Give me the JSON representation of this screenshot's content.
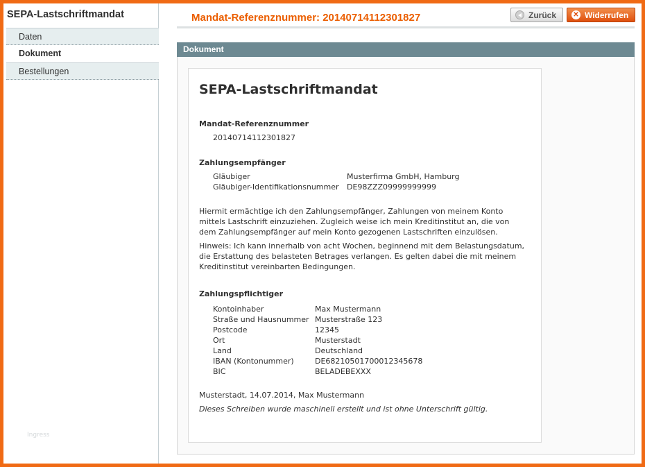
{
  "sidebar": {
    "title": "SEPA-Lastschriftmandat",
    "tabs": [
      {
        "label": "Daten",
        "active": false
      },
      {
        "label": "Dokument",
        "active": true
      },
      {
        "label": "Bestellungen",
        "active": false
      }
    ],
    "footnote": "Ingress"
  },
  "header": {
    "title": "Mandat-Referenznummer: 20140714112301827",
    "back_label": "Zurück",
    "back_icon": "arrow-left-circle-icon",
    "revoke_label": "Widerrufen",
    "revoke_icon": "x-circle-icon"
  },
  "section": {
    "title": "Dokument"
  },
  "document": {
    "title": "SEPA-Lastschriftmandat",
    "ref_heading": "Mandat-Referenznummer",
    "ref_value": "20140714112301827",
    "payee_heading": "Zahlungsempfänger",
    "payee": [
      {
        "key": "Gläubiger",
        "value": "Musterfirma GmbH, Hamburg"
      },
      {
        "key": "Gläubiger-Identifikationsnummer",
        "value": "DE98ZZZ09999999999"
      }
    ],
    "authorization_text": "Hiermit ermächtige ich den Zahlungsempfänger, Zahlungen von meinem Konto mittels Lastschrift einzuziehen. Zugleich weise ich mein Kreditinstitut an, die von dem Zahlungsempfänger auf mein Konto gezogenen Lastschriften einzulösen.",
    "notice_text": "Hinweis: Ich kann innerhalb von acht Wochen, beginnend mit dem Belastungsdatum, die Erstattung des belasteten Betrages verlangen. Es gelten dabei die mit meinem Kreditinstitut vereinbarten Bedingungen.",
    "payer_heading": "Zahlungspflichtiger",
    "payer": [
      {
        "key": "Kontoinhaber",
        "value": "Max Mustermann"
      },
      {
        "key": "Straße und Hausnummer",
        "value": "Musterstraße 123"
      },
      {
        "key": "Postcode",
        "value": "12345"
      },
      {
        "key": "Ort",
        "value": "Musterstadt"
      },
      {
        "key": "Land",
        "value": "Deutschland"
      },
      {
        "key": "IBAN (Kontonummer)",
        "value": "DE68210501700012345678"
      },
      {
        "key": "BIC",
        "value": "BELADEBEXXX"
      }
    ],
    "signature_line": "Musterstadt, 14.07.2014, Max Mustermann",
    "footer_note": "Dieses Schreiben wurde maschinell erstellt und ist ohne Unterschrift gültig."
  },
  "colors": {
    "accent": "#eb5e00",
    "frame": "#f06a14",
    "section_header": "#6d8992"
  }
}
